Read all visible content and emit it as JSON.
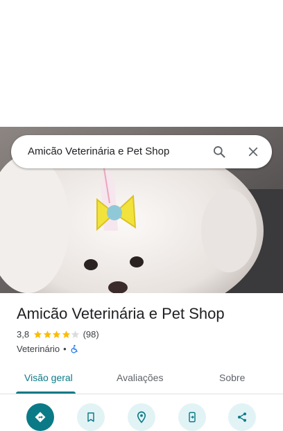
{
  "search": {
    "value": "Amicão Veterinária e Pet Shop"
  },
  "place": {
    "title": "Amicão Veterinária e Pet Shop",
    "rating": "3,8",
    "stars": 4,
    "reviews_count": "(98)",
    "category": "Veterinário",
    "separator": "•",
    "accessibility_icon": "wheelchair-icon"
  },
  "tabs": [
    {
      "label": "Visão geral",
      "active": true
    },
    {
      "label": "Avaliações",
      "active": false
    },
    {
      "label": "Sobre",
      "active": false
    }
  ],
  "actions": [
    {
      "icon": "directions-icon"
    },
    {
      "icon": "save-icon"
    },
    {
      "icon": "nearby-icon"
    },
    {
      "icon": "send-to-phone-icon"
    },
    {
      "icon": "share-icon"
    }
  ],
  "colors": {
    "accent": "#0b7a87",
    "star": "#fbbc04",
    "star_empty": "#dadce0",
    "accessibility": "#1a73e8"
  }
}
